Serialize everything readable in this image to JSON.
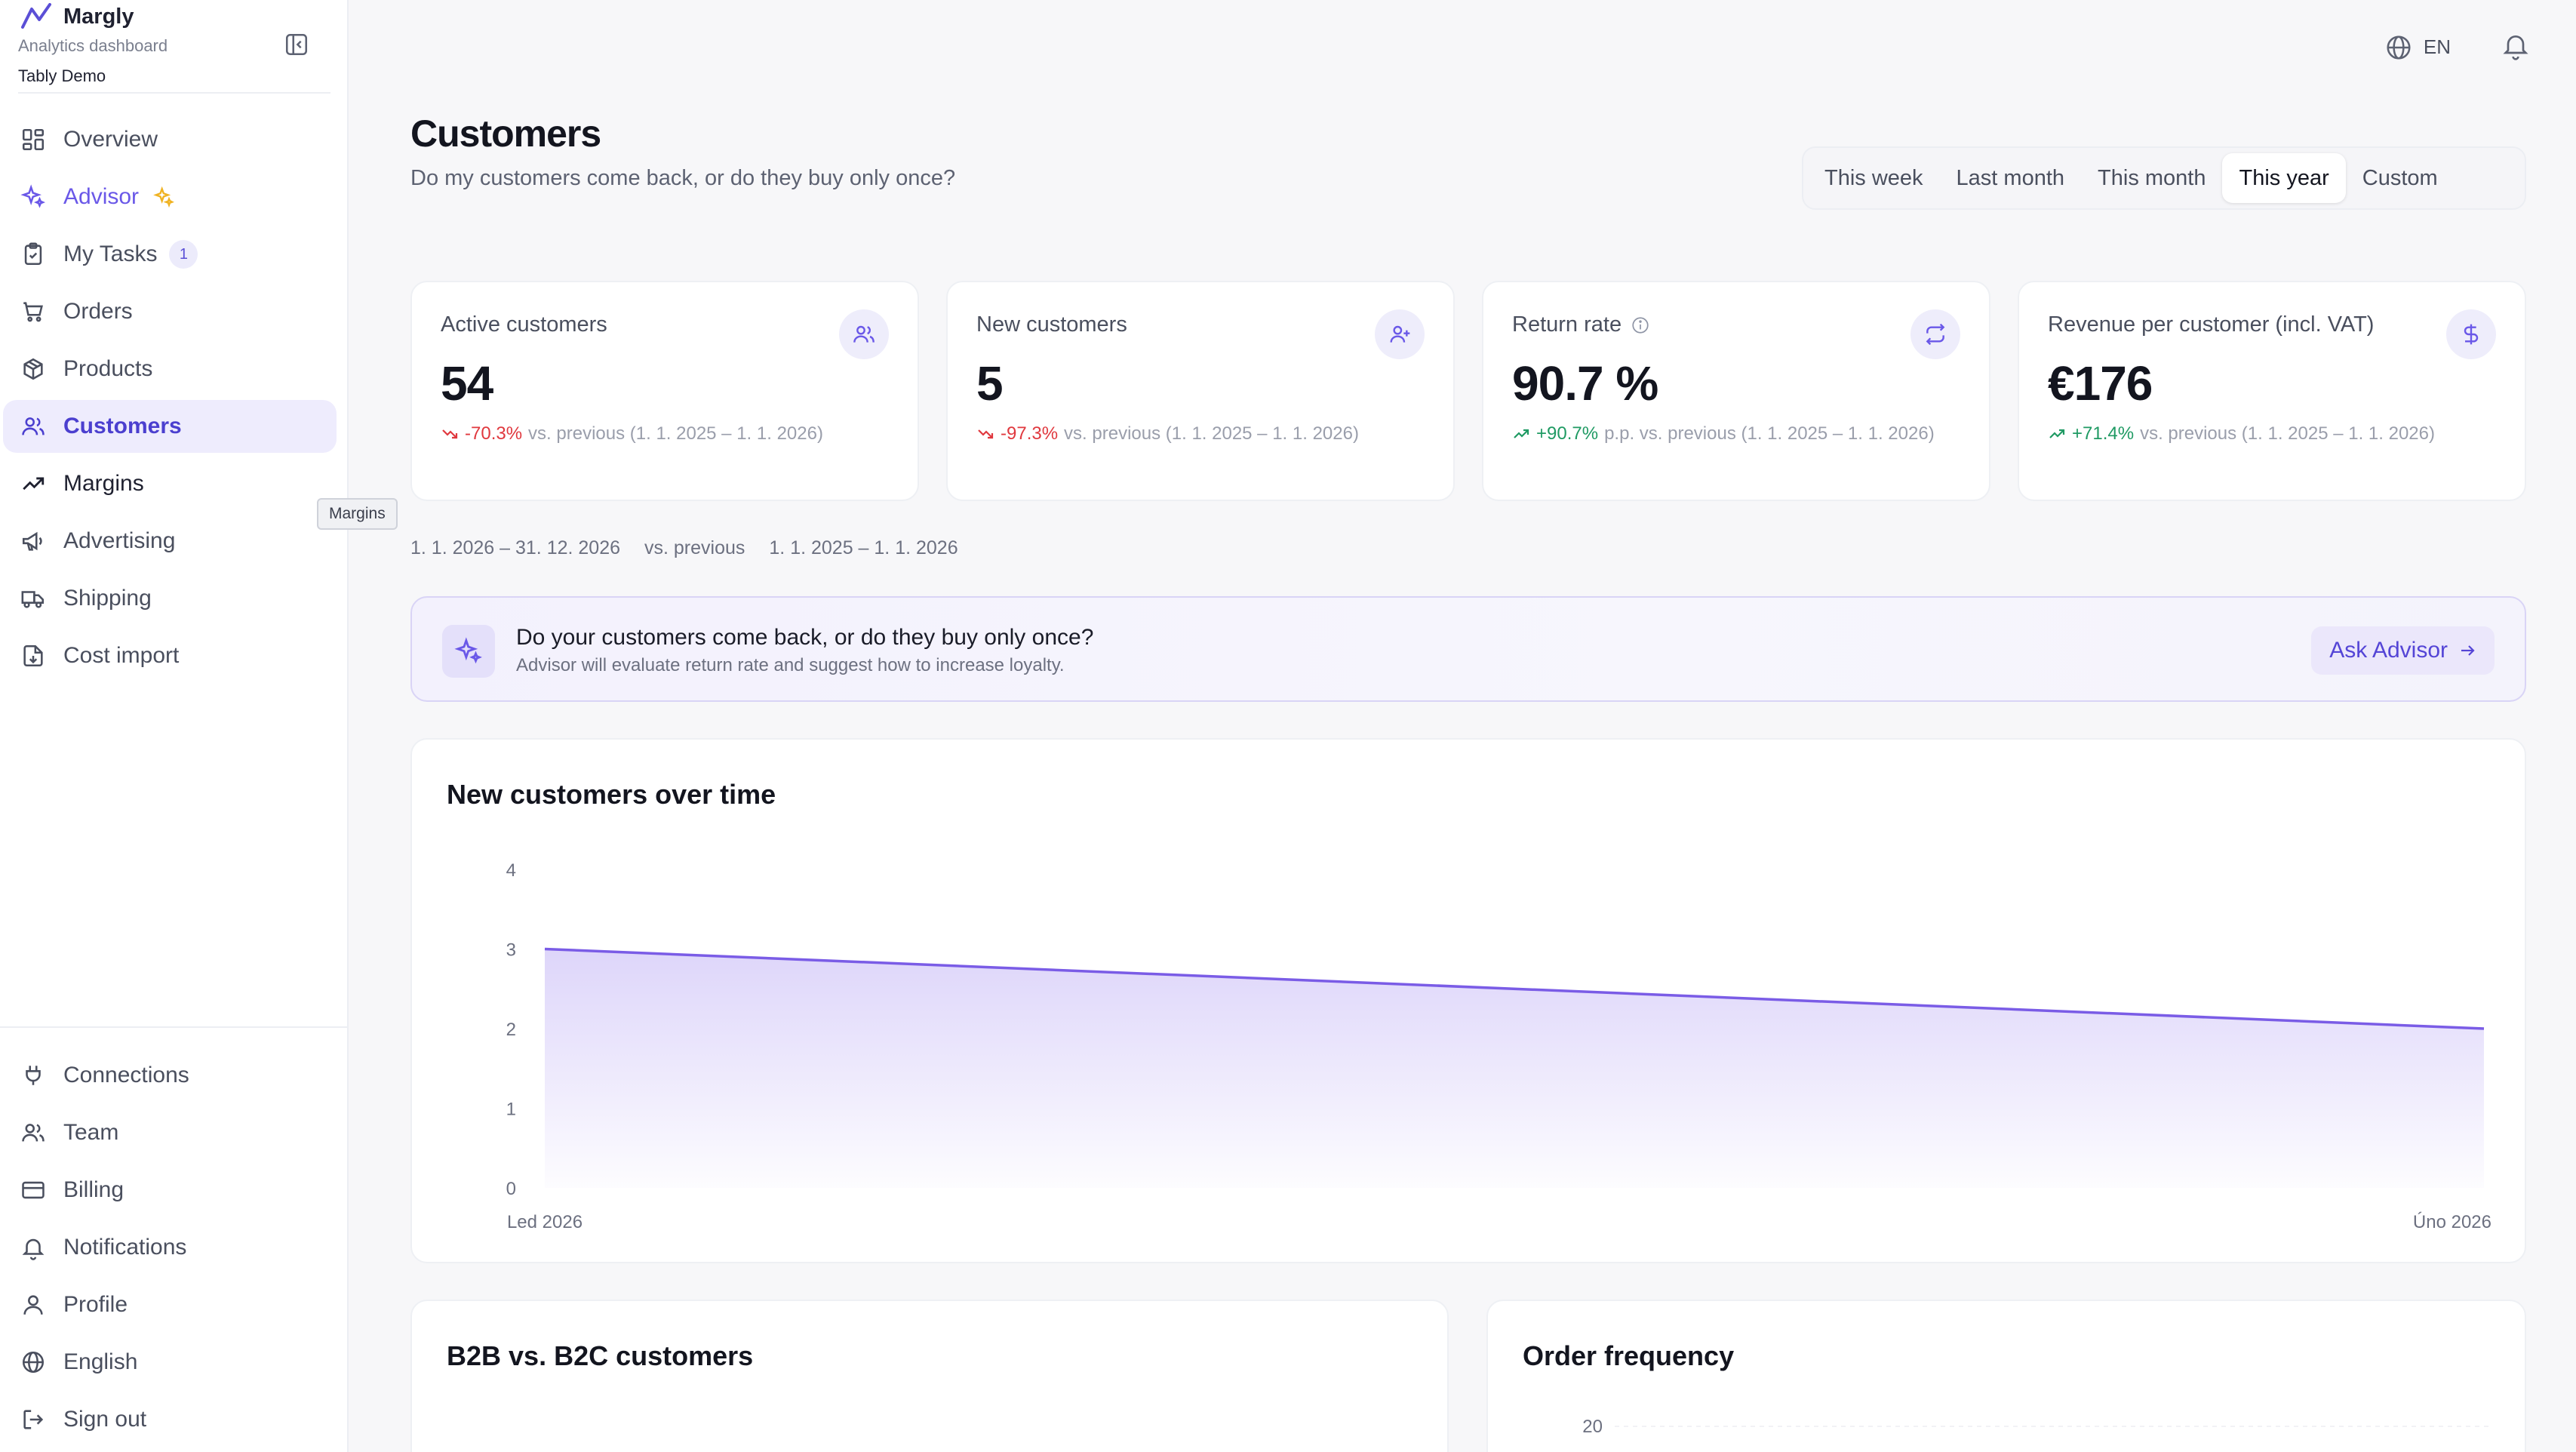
{
  "app": {
    "name": "Margly",
    "subtitle": "Analytics dashboard",
    "workspace": "Tably Demo"
  },
  "sidebar": {
    "main_items": [
      {
        "label": "Overview",
        "icon": "grid-icon"
      },
      {
        "label": "Advisor",
        "icon": "sparkles-icon"
      },
      {
        "label": "My Tasks",
        "icon": "clipboard-check-icon",
        "badge": "1"
      },
      {
        "label": "Orders",
        "icon": "cart-icon"
      },
      {
        "label": "Products",
        "icon": "box-icon"
      },
      {
        "label": "Customers",
        "icon": "users-icon",
        "active": true
      },
      {
        "label": "Margins",
        "icon": "trending-up-icon"
      },
      {
        "label": "Advertising",
        "icon": "megaphone-icon"
      },
      {
        "label": "Shipping",
        "icon": "truck-icon"
      },
      {
        "label": "Cost import",
        "icon": "file-import-icon"
      }
    ],
    "bottom_items": [
      {
        "label": "Connections",
        "icon": "plug-icon"
      },
      {
        "label": "Team",
        "icon": "team-icon"
      },
      {
        "label": "Billing",
        "icon": "credit-card-icon"
      },
      {
        "label": "Notifications",
        "icon": "bell-icon"
      },
      {
        "label": "Profile",
        "icon": "user-icon"
      },
      {
        "label": "English",
        "icon": "globe-icon"
      },
      {
        "label": "Sign out",
        "icon": "sign-out-icon"
      }
    ],
    "tooltip": "Margins"
  },
  "header": {
    "language": "EN"
  },
  "page": {
    "title": "Customers",
    "subtitle": "Do my customers come back, or do they buy only once?"
  },
  "range_tabs": {
    "options": [
      "This week",
      "Last month",
      "This month",
      "This year",
      "Custom"
    ],
    "selected": "This year"
  },
  "kpis": [
    {
      "label": "Active customers",
      "value": "54",
      "delta": "-70.3%",
      "trend": "down",
      "suffix": "vs. previous (1. 1. 2025 – 1. 1. 2026)",
      "icon": "users-icon"
    },
    {
      "label": "New customers",
      "value": "5",
      "delta": "-97.3%",
      "trend": "down",
      "suffix": "vs. previous (1. 1. 2025 – 1. 1. 2026)",
      "icon": "user-plus-icon"
    },
    {
      "label": "Return rate",
      "value": "90.7 %",
      "delta": "+90.7%",
      "trend": "up",
      "suffix": "p.p. vs. previous (1. 1. 2025 – 1. 1. 2026)",
      "icon": "repeat-icon",
      "info": true
    },
    {
      "label": "Revenue per customer (incl. VAT)",
      "value": "€176",
      "delta": "+71.4%",
      "trend": "up",
      "suffix": "vs. previous (1. 1. 2025 – 1. 1. 2026)",
      "icon": "dollar-icon"
    }
  ],
  "period": {
    "current": "1. 1. 2026 – 31. 12. 2026",
    "vs": "vs. previous",
    "previous": "1. 1. 2025 – 1. 1. 2026"
  },
  "advisor_banner": {
    "title": "Do your customers come back, or do they buy only once?",
    "subtitle": "Advisor will evaluate return rate and suggest how to increase loyalty.",
    "button": "Ask Advisor"
  },
  "colors": {
    "accent": "#7a5ce6",
    "negative": "#e0383e",
    "positive": "#1f9a63"
  },
  "chart_data": [
    {
      "type": "area",
      "title": "New customers over time",
      "x": [
        "Led 2026",
        "Úno 2026"
      ],
      "series": [
        {
          "values": [
            3,
            2
          ]
        }
      ],
      "ylim": [
        0,
        4
      ],
      "yticks": [
        0,
        1,
        2,
        3,
        4
      ],
      "grid": false
    },
    {
      "type": "pie",
      "title": "B2B vs. B2C customers"
    },
    {
      "type": "bar",
      "title": "Order frequency",
      "yticks_visible": [
        20
      ],
      "grid": true
    }
  ]
}
